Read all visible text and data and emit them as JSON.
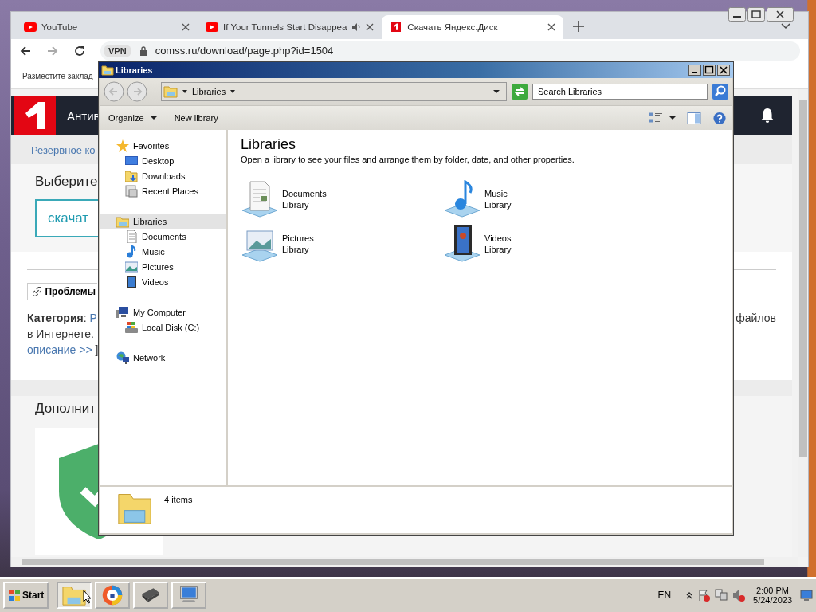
{
  "browser": {
    "tabs": [
      {
        "title": "YouTube",
        "kind": "youtube",
        "audio": false,
        "selected": false
      },
      {
        "title": "If Your Tunnels Start Disappea",
        "kind": "youtube",
        "audio": true,
        "selected": false
      },
      {
        "title": "Скачать Яндекс.Диск",
        "kind": "site",
        "audio": false,
        "selected": true
      }
    ],
    "vpn_badge": "VPN",
    "url": "comss.ru/download/page.php?id=1504",
    "bookmarks_hint": "Разместите заклад",
    "page": {
      "site_nav": "Антив",
      "backup_link": "Резервное ко",
      "heading": "Выберите",
      "download_button": "скачат",
      "problems_button": "Проблемы",
      "category_text": "**Категория**:",
      "category_link": "Р",
      "right_text": "файлов",
      "line2": "в Интернете.",
      "more_link": "описание >>",
      "bracket": "]",
      "section_heading": "Дополнит"
    }
  },
  "explorer": {
    "title": "Libraries",
    "breadcrumb": "Libraries",
    "search_placeholder": "Search Libraries",
    "commands": [
      {
        "label": "Organize",
        "dropdown": true
      },
      {
        "label": "New library",
        "dropdown": false
      }
    ],
    "nav": [
      {
        "label": "Favorites",
        "kind": "star",
        "selected": false,
        "children": [
          {
            "label": "Desktop",
            "kind": "desktop",
            "selected": false
          },
          {
            "label": "Downloads",
            "kind": "downloads",
            "selected": false
          },
          {
            "label": "Recent Places",
            "kind": "recent",
            "selected": false
          }
        ]
      },
      {
        "label": "Libraries",
        "kind": "libraries",
        "selected": true,
        "children": [
          {
            "label": "Documents",
            "kind": "documents",
            "selected": false
          },
          {
            "label": "Music",
            "kind": "music",
            "selected": false
          },
          {
            "label": "Pictures",
            "kind": "pictures",
            "selected": false
          },
          {
            "label": "Videos",
            "kind": "videos",
            "selected": false
          }
        ]
      },
      {
        "label": "My Computer",
        "kind": "computer",
        "selected": false,
        "children": [
          {
            "label": "Local Disk (C:)",
            "kind": "disk",
            "selected": false
          }
        ]
      },
      {
        "label": "Network",
        "kind": "network",
        "selected": false
      }
    ],
    "heading": "Libraries",
    "description": "Open a library to see your files and arrange them by folder, date, and other properties.",
    "items": [
      {
        "name": "Documents",
        "type": "Library",
        "kind": "documents"
      },
      {
        "name": "Music",
        "type": "Library",
        "kind": "music"
      },
      {
        "name": "Pictures",
        "type": "Library",
        "kind": "pictures"
      },
      {
        "name": "Videos",
        "type": "Library",
        "kind": "videos"
      }
    ],
    "status": "4 items"
  },
  "taskbar": {
    "start": "Start",
    "apps": [
      {
        "kind": "explorer",
        "selected": true
      },
      {
        "kind": "browser",
        "selected": false
      },
      {
        "kind": "chip",
        "selected": false
      },
      {
        "kind": "monitor",
        "selected": false
      }
    ],
    "language": "EN",
    "time": "2:00 PM",
    "date": "5/24/2023"
  }
}
